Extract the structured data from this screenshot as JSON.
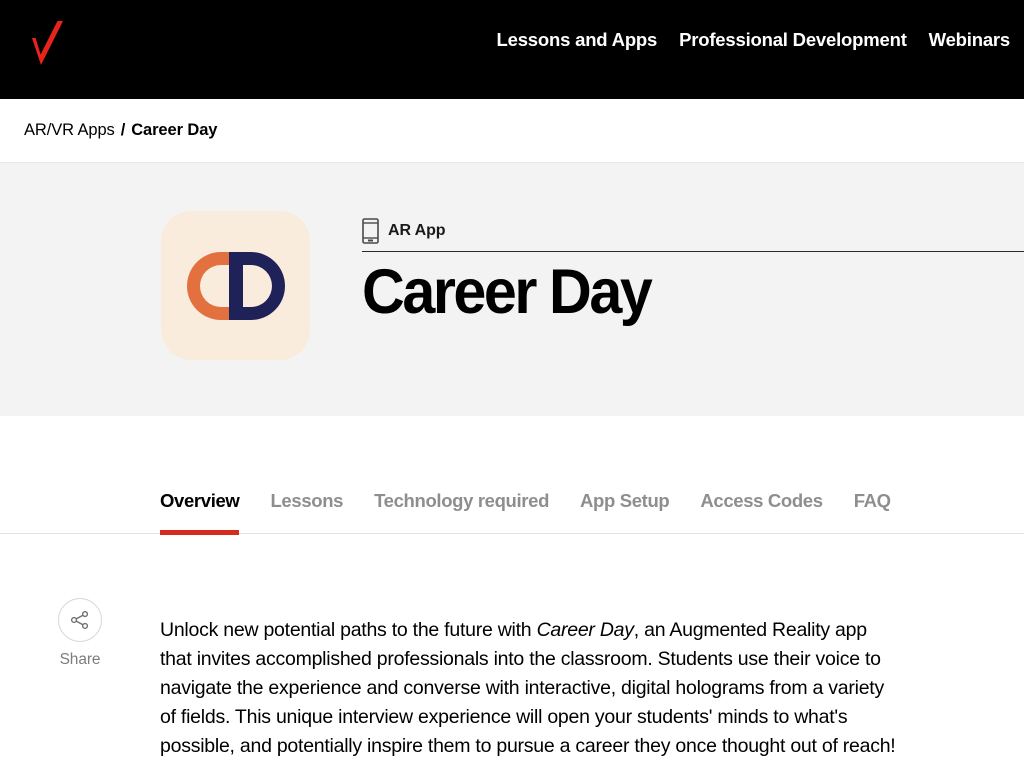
{
  "header": {
    "logo_name": "verizon-checkmark-logo",
    "logo_color": "#e8241a",
    "background": "#000000",
    "nav_items": [
      {
        "label": "Lessons and Apps"
      },
      {
        "label": "Professional Development"
      },
      {
        "label": "Webinars"
      }
    ]
  },
  "breadcrumb": {
    "parent": "AR/VR Apps",
    "separator": "/",
    "current": "Career Day"
  },
  "hero": {
    "background": "#f3f3f3",
    "app_icon": {
      "name": "career-day-app-icon",
      "background": "#f9ecdd",
      "letters": "CD",
      "c_color": "#e3703f",
      "d_color": "#1f2258"
    },
    "app_type": "AR App",
    "app_type_icon": "mobile-phone-icon",
    "title": "Career Day"
  },
  "tabs": {
    "active_index": 0,
    "active_color": "#000000",
    "inactive_color": "#8e8e8e",
    "underline_color": "#d52b1e",
    "items": [
      {
        "label": "Overview"
      },
      {
        "label": "Lessons"
      },
      {
        "label": "Technology required"
      },
      {
        "label": "App Setup"
      },
      {
        "label": "Access Codes"
      },
      {
        "label": "FAQ"
      }
    ]
  },
  "share": {
    "icon": "share-nodes-icon",
    "label": "Share"
  },
  "overview": {
    "paragraph_part1": "Unlock new potential paths to the future with ",
    "paragraph_emphasis": "Career Day",
    "paragraph_part2": ", an Augmented Reality app that invites accomplished professionals into the classroom. Students use their voice to navigate the experience and converse with interactive, digital holograms from a variety of fields. This unique interview experience will open your students' minds to what's possible, and potentially inspire them to pursue a career they once thought out of reach!"
  }
}
